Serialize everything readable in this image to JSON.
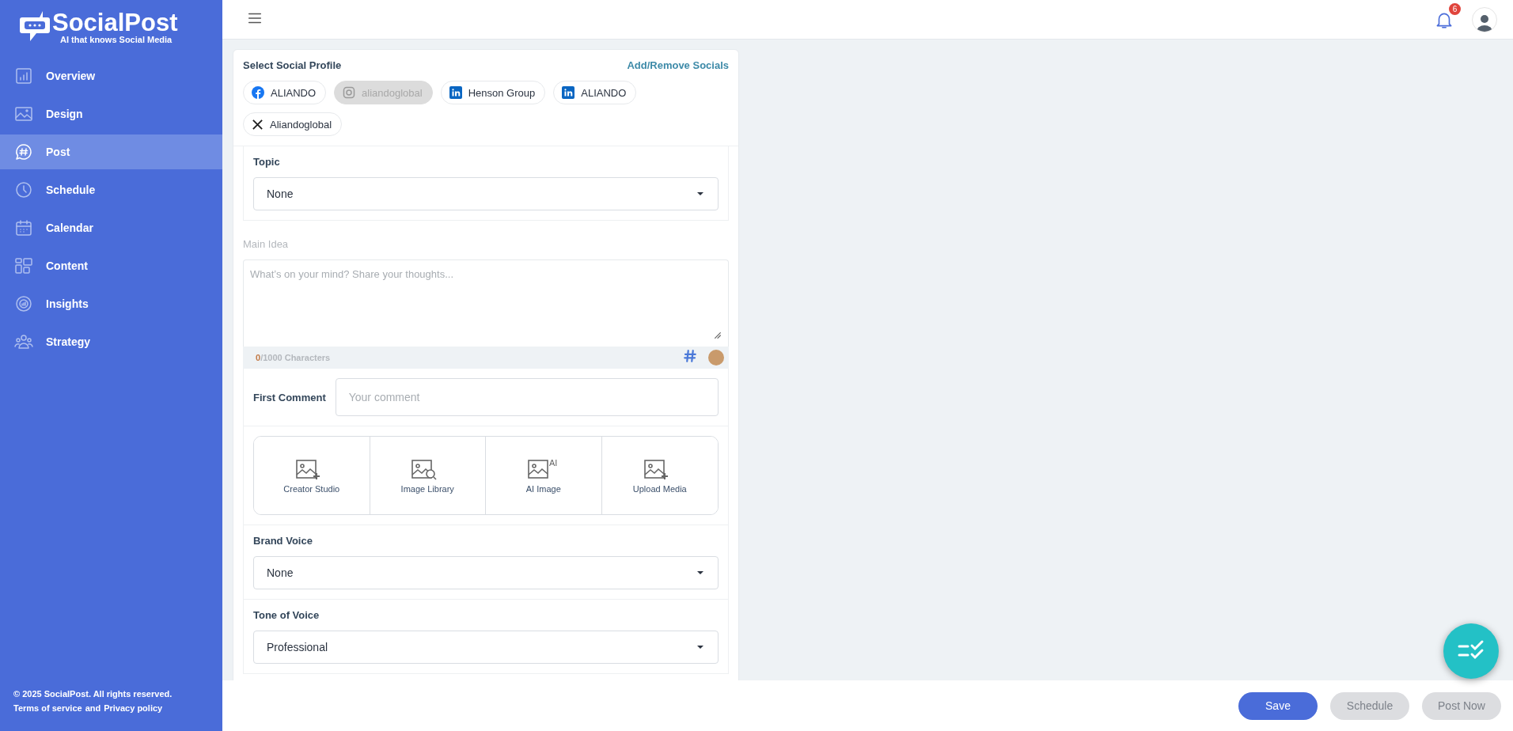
{
  "brand": {
    "name": "SocialPost",
    "tagline": "AI that knows Social Media"
  },
  "sidebar": {
    "items": [
      {
        "label": "Overview",
        "selected": false
      },
      {
        "label": "Design",
        "selected": false
      },
      {
        "label": "Post",
        "selected": true
      },
      {
        "label": "Schedule",
        "selected": false
      },
      {
        "label": "Calendar",
        "selected": false
      },
      {
        "label": "Content",
        "selected": false
      },
      {
        "label": "Insights",
        "selected": false
      },
      {
        "label": "Strategy",
        "selected": false
      }
    ],
    "copyright": "© 2025 SocialPost. All rights reserved.",
    "legal": [
      {
        "text": "Terms of service"
      },
      {
        "text": "and"
      },
      {
        "text": "Privacy policy"
      }
    ]
  },
  "header": {
    "notification_count": "6"
  },
  "profiles": {
    "title": "Select Social Profile",
    "link": "Add/Remove Socials",
    "chips": [
      {
        "kind": "facebook",
        "label": "ALIANDO",
        "disabled": false
      },
      {
        "kind": "instagram",
        "label": "aliandoglobal",
        "disabled": true
      },
      {
        "kind": "linkedin",
        "label": "Henson Group",
        "disabled": false
      },
      {
        "kind": "linkedin",
        "label": "ALIANDO",
        "disabled": false
      },
      {
        "kind": "x",
        "label": "Aliandoglobal",
        "disabled": false
      }
    ]
  },
  "topic": {
    "label": "Topic",
    "value": "None"
  },
  "main_idea": {
    "label": "Main Idea",
    "placeholder": "What’s on your mind? Share your thoughts...",
    "char_count": "0",
    "char_limit": "/1000 Characters"
  },
  "first_comment": {
    "label": "First Comment",
    "placeholder": "Your comment"
  },
  "media_options": [
    {
      "label": "Creator Studio"
    },
    {
      "label": "Image Library"
    },
    {
      "label": "AI Image",
      "icon_text": "AI"
    },
    {
      "label": "Upload Media"
    }
  ],
  "brand_voice": {
    "label": "Brand Voice",
    "value": "None"
  },
  "tone_of_voice": {
    "label": "Tone of Voice",
    "value": "Professional"
  },
  "actions": [
    {
      "label": "Save",
      "disabled": false
    },
    {
      "label": "Schedule",
      "disabled": true
    },
    {
      "label": "Post Now",
      "disabled": true
    }
  ]
}
